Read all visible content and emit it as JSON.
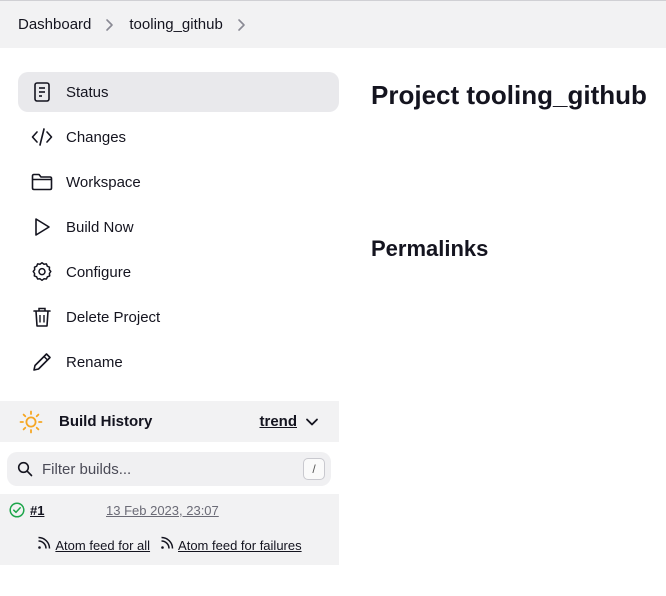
{
  "breadcrumb": {
    "items": [
      "Dashboard",
      "tooling_github"
    ]
  },
  "sidebar": {
    "items": [
      {
        "label": "Status",
        "icon": "document-icon",
        "active": true
      },
      {
        "label": "Changes",
        "icon": "code-icon"
      },
      {
        "label": "Workspace",
        "icon": "folder-icon"
      },
      {
        "label": "Build Now",
        "icon": "play-icon"
      },
      {
        "label": "Configure",
        "icon": "gear-icon"
      },
      {
        "label": "Delete Project",
        "icon": "trash-icon"
      },
      {
        "label": "Rename",
        "icon": "pencil-icon"
      }
    ]
  },
  "build_history": {
    "title": "Build History",
    "trend_label": "trend",
    "filter_placeholder": "Filter builds...",
    "shortcut": "/",
    "builds": [
      {
        "number": "#1",
        "date": "13 Feb 2023, 23:07",
        "status": "success"
      }
    ],
    "feed_all": "Atom feed for all",
    "feed_failures": "Atom feed for failures"
  },
  "main": {
    "title": "Project tooling_github",
    "permalinks_heading": "Permalinks"
  },
  "colors": {
    "success": "#1ea64b",
    "sun": "#f5a623",
    "active_bg": "#e9e9ec"
  }
}
